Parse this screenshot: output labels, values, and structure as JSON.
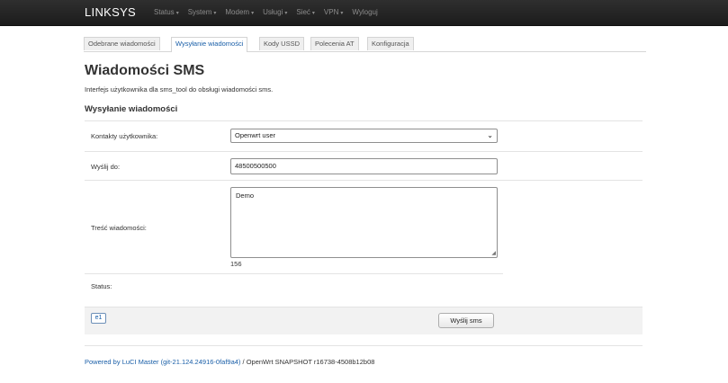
{
  "header": {
    "brand": "LINKSYS",
    "menu": [
      {
        "label": "Status",
        "caret": "▾"
      },
      {
        "label": "System",
        "caret": "▾"
      },
      {
        "label": "Modem",
        "caret": "▾"
      },
      {
        "label": "Usługi",
        "caret": "▾"
      },
      {
        "label": "Sieć",
        "caret": "▾"
      },
      {
        "label": "VPN",
        "caret": "▾"
      },
      {
        "label": "Wyloguj",
        "caret": ""
      }
    ]
  },
  "tabs": [
    {
      "label": "Odebrane wiadomości",
      "active": false
    },
    {
      "label": "Wysyłanie wiadomości",
      "active": true
    },
    {
      "label": "Kody USSD",
      "active": false
    },
    {
      "label": "Polecenia AT",
      "active": false
    },
    {
      "label": "Konfiguracja",
      "active": false
    }
  ],
  "page": {
    "title": "Wiadomości SMS",
    "description": "Interfejs użytkownika dla sms_tool do obsługi wiadomości sms.",
    "section_title": "Wysyłanie wiadomości"
  },
  "form": {
    "contacts_label": "Kontakty użytkownika:",
    "contacts_value": "Openwrt user",
    "send_to_label": "Wyślij do:",
    "send_to_value": "48500500500",
    "message_label": "Treść wiadomości:",
    "message_value": "Demo",
    "char_count": "156",
    "status_label": "Status:"
  },
  "actions": {
    "e1_label": "e1",
    "send_label": "Wyślij sms"
  },
  "footer": {
    "link_text": "Powered by LuCI Master (git-21.124.24916-0faf9a4)",
    "rest_text": " / OpenWrt SNAPSHOT r16738-4508b12b08"
  },
  "icons": {
    "menu_caret": "chevron-down-icon",
    "select_caret": "chevron-down-icon",
    "resize": "resize-grip-icon"
  },
  "colors": {
    "topbar": "#1c1c1c",
    "link": "#1a5fa8",
    "active_tab_text": "#1a5fa8"
  }
}
